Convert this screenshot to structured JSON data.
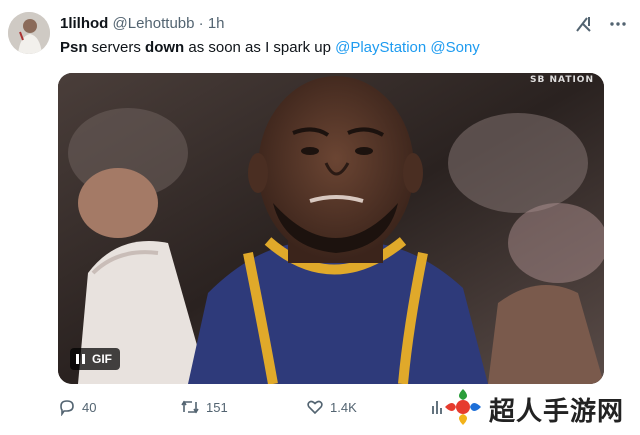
{
  "tweet": {
    "display_name": "1lilhod",
    "handle": "@Lehottubb",
    "separator": "·",
    "time": "1h",
    "text_parts": {
      "p1": "Psn",
      "p2": " servers ",
      "p3": "down",
      "p4": " as soon as I spark up ",
      "mention1": "@PlayStation",
      "mention2": "@Sony"
    }
  },
  "media": {
    "tv_logo": "SB NATION",
    "gif_label": "GIF",
    "pause_icon": "pause-icon"
  },
  "actions": {
    "replies": "40",
    "reposts": "151",
    "likes": "1.4K",
    "views": ""
  },
  "icons": {
    "grok": "grok-icon",
    "more": "more-icon",
    "reply": "reply-icon",
    "repost": "repost-icon",
    "like": "like-icon",
    "views": "views-icon"
  },
  "watermark": {
    "text": "超人手游网"
  },
  "colors": {
    "accent": "#1d9bf0",
    "muted": "#536471",
    "text": "#0f1419",
    "jersey_blue": "#2e3a7a",
    "jersey_trim": "#e0a92a"
  }
}
